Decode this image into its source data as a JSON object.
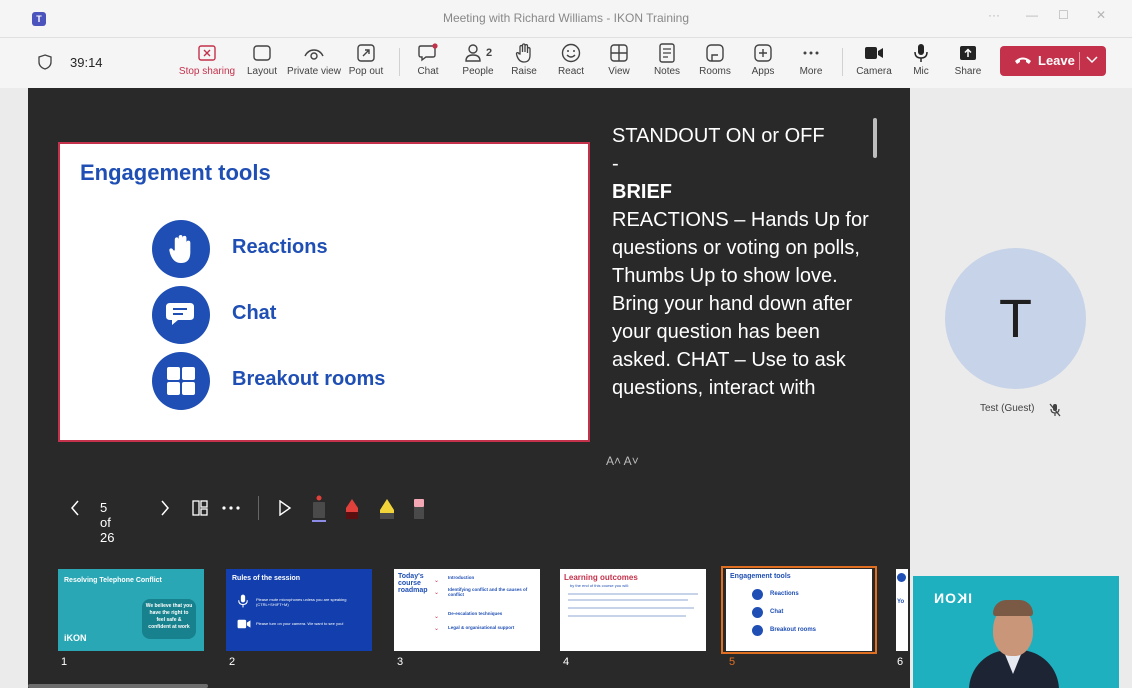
{
  "window": {
    "title": "Meeting with Richard Williams - IKON Training",
    "app_icon": "teams-icon",
    "controls": [
      "···",
      "—",
      "☐",
      "✕"
    ]
  },
  "toolbar": {
    "timer": "39:14",
    "buttons": [
      {
        "id": "stop-sharing",
        "label": "Stop sharing",
        "icon": "stop-share-icon"
      },
      {
        "id": "layout",
        "label": "Layout",
        "icon": "layout-icon"
      },
      {
        "id": "private-view",
        "label": "Private view",
        "icon": "eye-icon"
      },
      {
        "id": "pop-out",
        "label": "Pop out",
        "icon": "pop-out-icon"
      },
      {
        "id": "chat",
        "label": "Chat",
        "icon": "chat-icon"
      },
      {
        "id": "people",
        "label": "People",
        "icon": "people-icon",
        "badge": "2"
      },
      {
        "id": "raise",
        "label": "Raise",
        "icon": "hand-icon"
      },
      {
        "id": "react",
        "label": "React",
        "icon": "smiley-icon"
      },
      {
        "id": "view",
        "label": "View",
        "icon": "view-grid-icon"
      },
      {
        "id": "notes",
        "label": "Notes",
        "icon": "notes-icon"
      },
      {
        "id": "rooms",
        "label": "Rooms",
        "icon": "rooms-icon"
      },
      {
        "id": "apps",
        "label": "Apps",
        "icon": "plus-icon"
      },
      {
        "id": "more",
        "label": "More",
        "icon": "more-icon"
      },
      {
        "id": "camera",
        "label": "Camera",
        "icon": "camera-icon"
      },
      {
        "id": "mic",
        "label": "Mic",
        "icon": "mic-icon"
      },
      {
        "id": "share",
        "label": "Share",
        "icon": "share-icon"
      }
    ],
    "leave_label": "Leave"
  },
  "slide": {
    "heading": "Engagement tools",
    "items": [
      "Reactions",
      "Chat",
      "Breakout rooms"
    ]
  },
  "notes": {
    "line1": "STANDOUT ON or OFF",
    "line2": "-",
    "brief": "BRIEF",
    "body": "REACTIONS – Hands Up for questions or voting on polls, Thumbs Up to show love. Bring your hand down after your question has been asked. CHAT – Use to ask questions, interact with",
    "font_controls": "A˄  A˅"
  },
  "slide_controls": {
    "page": "5 of 26"
  },
  "thumbnails": [
    {
      "num": "1",
      "title": "Resolving Telephone Conflict",
      "text": "We believe that you have the right to feel safe & confident at work",
      "brand": "iKON"
    },
    {
      "num": "2",
      "title": "Rules of the session",
      "line1": "Please mute microphones unless you are speaking (CTRL+SHIFT+M)",
      "line2": "Please turn on your camera. We want to see you!"
    },
    {
      "num": "3",
      "title": "Today's course roadmap",
      "items": [
        "Introduction",
        "Identifying conflict and the causes of conflict",
        "De-escalation techniques",
        "Legal & organisational support"
      ]
    },
    {
      "num": "4",
      "title": "Learning outcomes",
      "subtitle": "by the end of this course you will:"
    },
    {
      "num": "5",
      "title": "Engagement tools",
      "items": [
        "Reactions",
        "Chat",
        "Breakout rooms"
      ]
    },
    {
      "num": "6",
      "title": "Yo"
    }
  ],
  "participant": {
    "initial": "T",
    "name": "Test (Guest)"
  },
  "self_view": {
    "logo": "IKON"
  },
  "colors": {
    "accent_red": "#c4314b",
    "slide_blue": "#1f4fb4",
    "stage_bg": "#292929",
    "thumb_selected": "#e06f22"
  }
}
